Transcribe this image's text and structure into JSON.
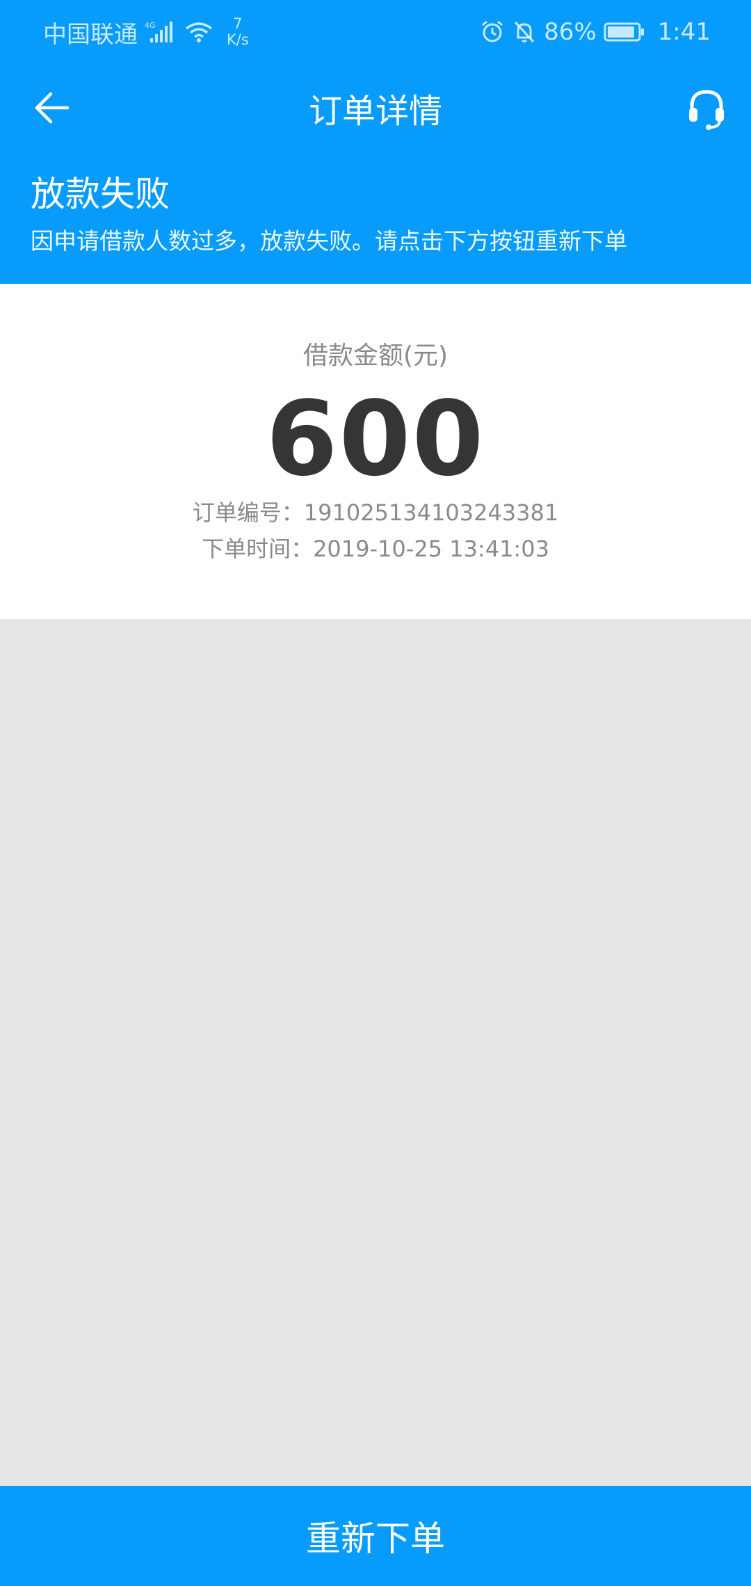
{
  "status_bar": {
    "carrier": "中国联通",
    "network_type": "4G",
    "net_speed_value": "7",
    "net_speed_unit": "K/s",
    "battery": "86%",
    "time": "1:41",
    "icons": [
      "signal-icon",
      "wifi-icon",
      "alarm-icon",
      "mute-bell-icon",
      "battery-icon"
    ]
  },
  "nav": {
    "title": "订单详情",
    "back_icon": "back-arrow-icon",
    "service_icon": "headset-icon"
  },
  "banner": {
    "title": "放款失败",
    "message": "因申请借款人数过多，放款失败。请点击下方按钮重新下单"
  },
  "order": {
    "amount_label": "借款金额(元)",
    "amount": "600",
    "order_no": "订单编号：191025134103243381",
    "order_time": "下单时间：2019-10-25 13:41:03"
  },
  "action": {
    "reorder_label": "重新下单"
  },
  "colors": {
    "primary": "#079bfb",
    "background": "#e5e5e5",
    "card": "#ffffff",
    "amount_text": "#353535",
    "secondary_text": "#8a8a8a"
  }
}
